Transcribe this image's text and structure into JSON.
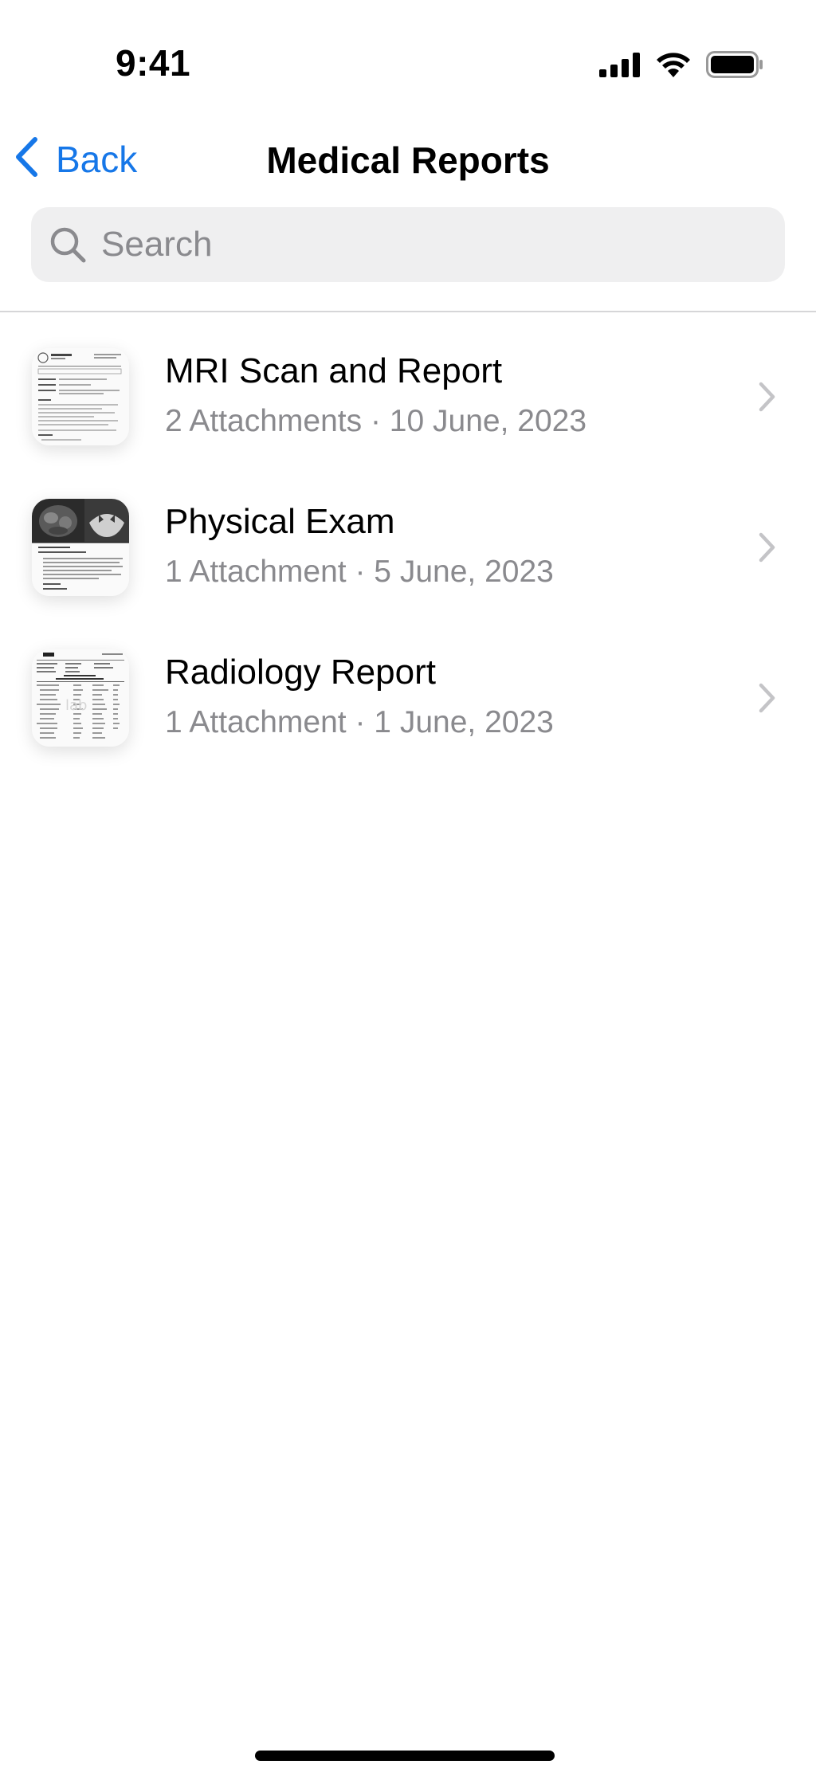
{
  "status_bar": {
    "time": "9:41"
  },
  "nav": {
    "back_label": "Back",
    "title": "Medical Reports"
  },
  "search": {
    "placeholder": "Search",
    "value": ""
  },
  "reports": [
    {
      "title": "MRI Scan and Report",
      "subtitle": "2 Attachments · 10 June, 2023",
      "thumbnail": "document-letter"
    },
    {
      "title": "Physical Exam",
      "subtitle": "1 Attachment · 5 June, 2023",
      "thumbnail": "scan-images"
    },
    {
      "title": "Radiology Report",
      "subtitle": "1 Attachment · 1 June, 2023",
      "thumbnail": "lab-table"
    }
  ],
  "colors": {
    "accent": "#1677e8",
    "secondary_text": "#8a8a8e",
    "search_bg": "#efeff0"
  }
}
